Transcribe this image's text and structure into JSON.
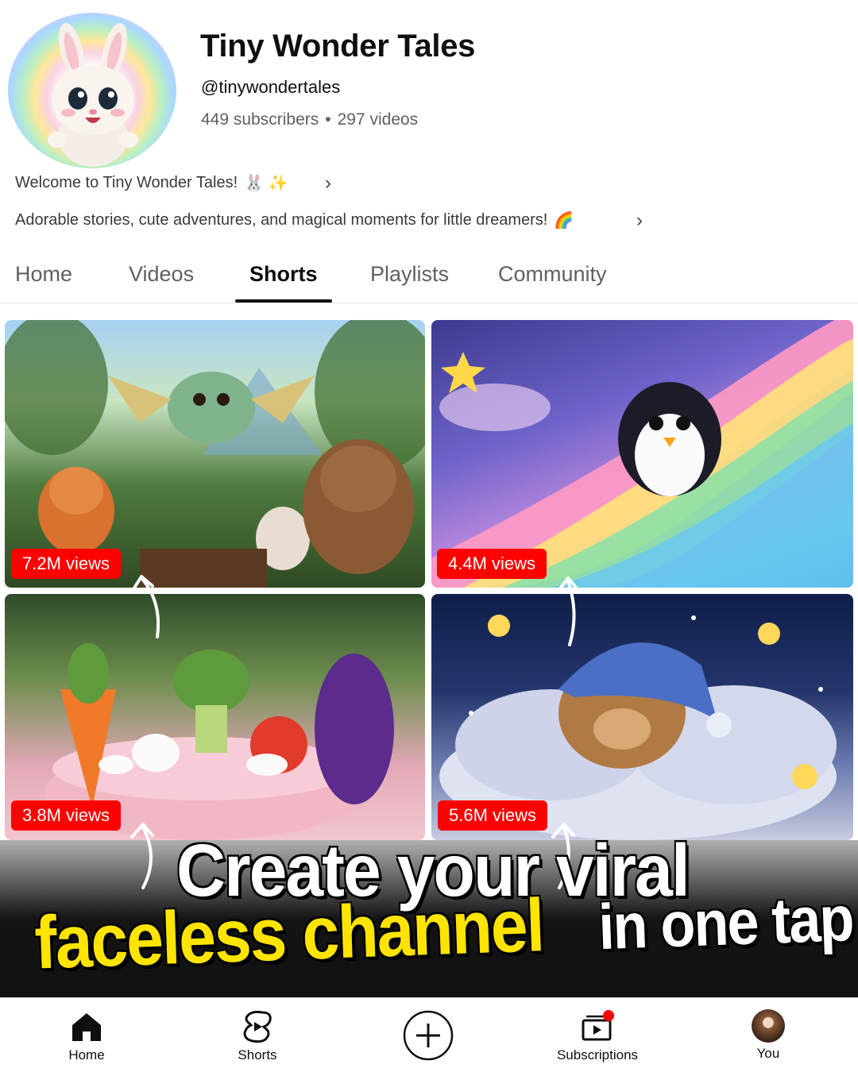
{
  "channel": {
    "name": "Tiny Wonder Tales",
    "handle": "@tinywondertales",
    "subscribers": "449 subscribers",
    "separator": "•",
    "videos": "297 videos",
    "avatar_icon": "bunny-rainbow-avatar"
  },
  "description": {
    "line1": "Welcome to Tiny Wonder Tales!",
    "line1_emoji": "🐰 ✨",
    "line2": "Adorable stories, cute adventures, and magical moments for little dreamers!",
    "line2_emoji": "🌈",
    "chevron": "›"
  },
  "tabs": [
    {
      "label": "Home",
      "active": false
    },
    {
      "label": "Videos",
      "active": false
    },
    {
      "label": "Shorts",
      "active": true
    },
    {
      "label": "Playlists",
      "active": false
    },
    {
      "label": "Community",
      "active": false
    }
  ],
  "shorts": [
    {
      "views": "7.2M views",
      "scene": "forest-animals-dragon"
    },
    {
      "views": "4.4M views",
      "scene": "penguin-rainbow-slide"
    },
    {
      "views": "3.8M views",
      "scene": "vegetable-tea-party"
    },
    {
      "views": "5.6M views",
      "scene": "sleeping-bear-cloud"
    }
  ],
  "promo": {
    "line1": "Create your viral",
    "line2_highlight": "faceless channel",
    "line2_rest": "in one tap",
    "highlight_color": "#ffe400"
  },
  "bottom_nav": [
    {
      "label": "Home",
      "icon": "home-icon"
    },
    {
      "label": "Shorts",
      "icon": "shorts-icon"
    },
    {
      "label": "",
      "icon": "create-plus-icon"
    },
    {
      "label": "Subscriptions",
      "icon": "subscriptions-icon"
    },
    {
      "label": "You",
      "icon": "you-avatar"
    }
  ],
  "colors": {
    "badge": "#ff0000",
    "text_primary": "#0f0f0f",
    "text_secondary": "#606060"
  }
}
